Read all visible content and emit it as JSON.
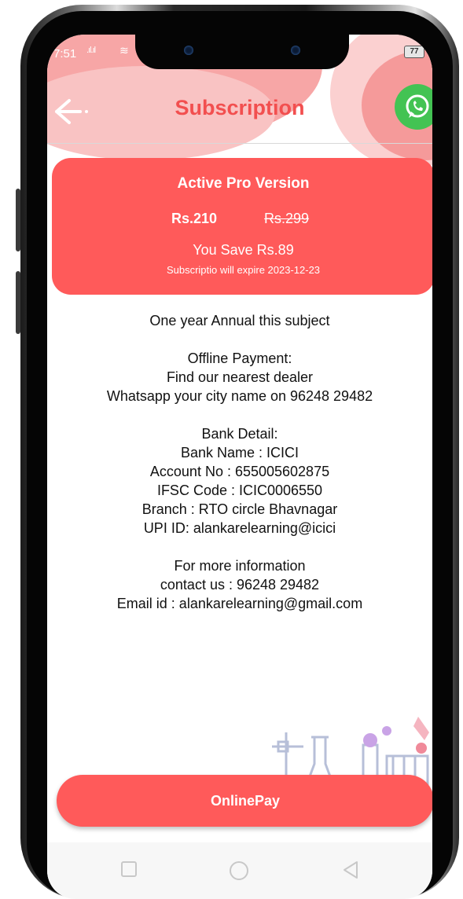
{
  "status_bar": {
    "time": "7:51",
    "signal": ".ıl.ıl",
    "wifi": "≋",
    "battery": "77"
  },
  "header": {
    "title": "Subscription",
    "back_icon": "arrow-left-icon",
    "whatsapp_icon": "whatsapp-icon"
  },
  "plan_card": {
    "title": "Active Pro Version",
    "price_current": "Rs.210",
    "price_original": "Rs.299",
    "savings": "You Save Rs.89",
    "expiry": "Subscriptio will expire 2023-12-23"
  },
  "info": {
    "annual": "One year Annual this subject",
    "offline_title": "Offline Payment:",
    "offline_line1": "Find our nearest dealer",
    "offline_line2": "Whatsapp your city name on 96248 29482",
    "bank_title": "Bank Detail:",
    "bank_name": "Bank Name : ICICI",
    "account_no": "Account No : 655005602875",
    "ifsc": "IFSC Code : ICIC0006550",
    "branch": "Branch : RTO circle Bhavnagar",
    "upi": "UPI ID: alankarelearning@icici",
    "more_info": "For more information",
    "contact": "contact us : 96248 29482",
    "email": "Email id :  alankarelearning@gmail.com"
  },
  "pay_button": {
    "label": "OnlinePay"
  },
  "colors": {
    "accent": "#ff5a5a",
    "title": "#f24f4f",
    "whatsapp": "#43c353"
  }
}
